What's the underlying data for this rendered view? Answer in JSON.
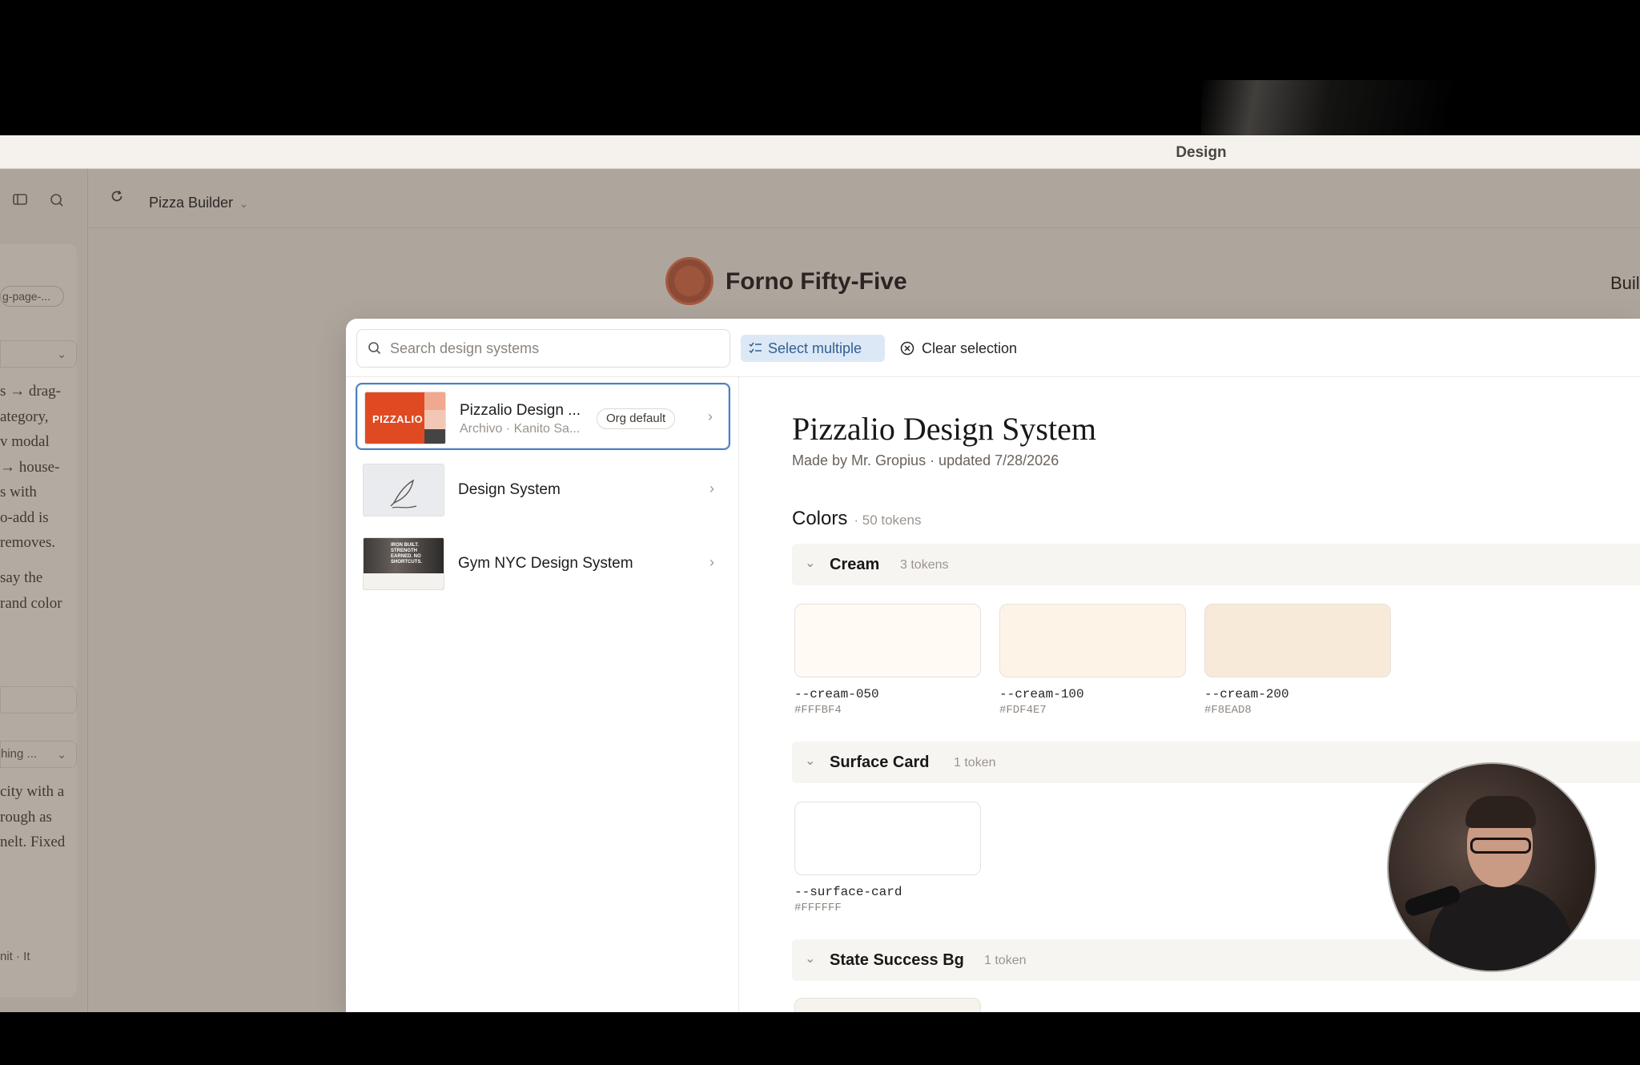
{
  "window": {
    "title": "Design"
  },
  "topbar": {
    "project_name": "Pizza Builder"
  },
  "brand": {
    "name": "Forno Fifty-Five",
    "nav_partial": "Buil"
  },
  "sidebar": {
    "chip": "g-page-...",
    "text_lines_1": [
      "s → drag-",
      "ategory,",
      "v modal",
      "→ house-",
      "s with",
      "o-add is",
      "removes."
    ],
    "text_lines_2": [
      "say the",
      "rand color"
    ],
    "row2": "hing ...",
    "text_lines_3": [
      "city with a",
      "rough as",
      "nelt. Fixed"
    ],
    "bottom": "nit · It"
  },
  "modal": {
    "search": {
      "placeholder": "Search design systems"
    },
    "select_multiple": "Select multiple",
    "clear_selection": "Clear selection",
    "design_systems": [
      {
        "name": "Pizzalio Design ...",
        "subtitle": "Archivo · Kanito Sa...",
        "badge": "Org default",
        "thumb_label": "PIZZALIO",
        "selected": true
      },
      {
        "name": "Design System",
        "selected": false
      },
      {
        "name": "Gym NYC Design System",
        "selected": false,
        "thumb_text": "IRON BUILT. STRENGTH EARNED. NO SHORTCUTS."
      }
    ],
    "detail": {
      "title": "Pizzalio Design System",
      "meta": "Made by Mr. Gropius · updated 7/28/2026",
      "section": {
        "name": "Colors",
        "count": "· 50 tokens"
      },
      "groups": [
        {
          "name": "Cream",
          "count": "3 tokens",
          "tokens": [
            {
              "name": "--cream-050",
              "hex": "#FFFBF4"
            },
            {
              "name": "--cream-100",
              "hex": "#FDF4E7"
            },
            {
              "name": "--cream-200",
              "hex": "#F8EAD8"
            }
          ]
        },
        {
          "name": "Surface Card",
          "count": "1 token",
          "tokens": [
            {
              "name": "--surface-card",
              "hex": "#FFFFFF"
            }
          ]
        },
        {
          "name": "State Success Bg",
          "count": "1 token",
          "tokens": []
        }
      ]
    }
  },
  "colors": {
    "accent": "#4d7fc0",
    "brand": "#e04a23",
    "overlay": "#aea69d"
  }
}
